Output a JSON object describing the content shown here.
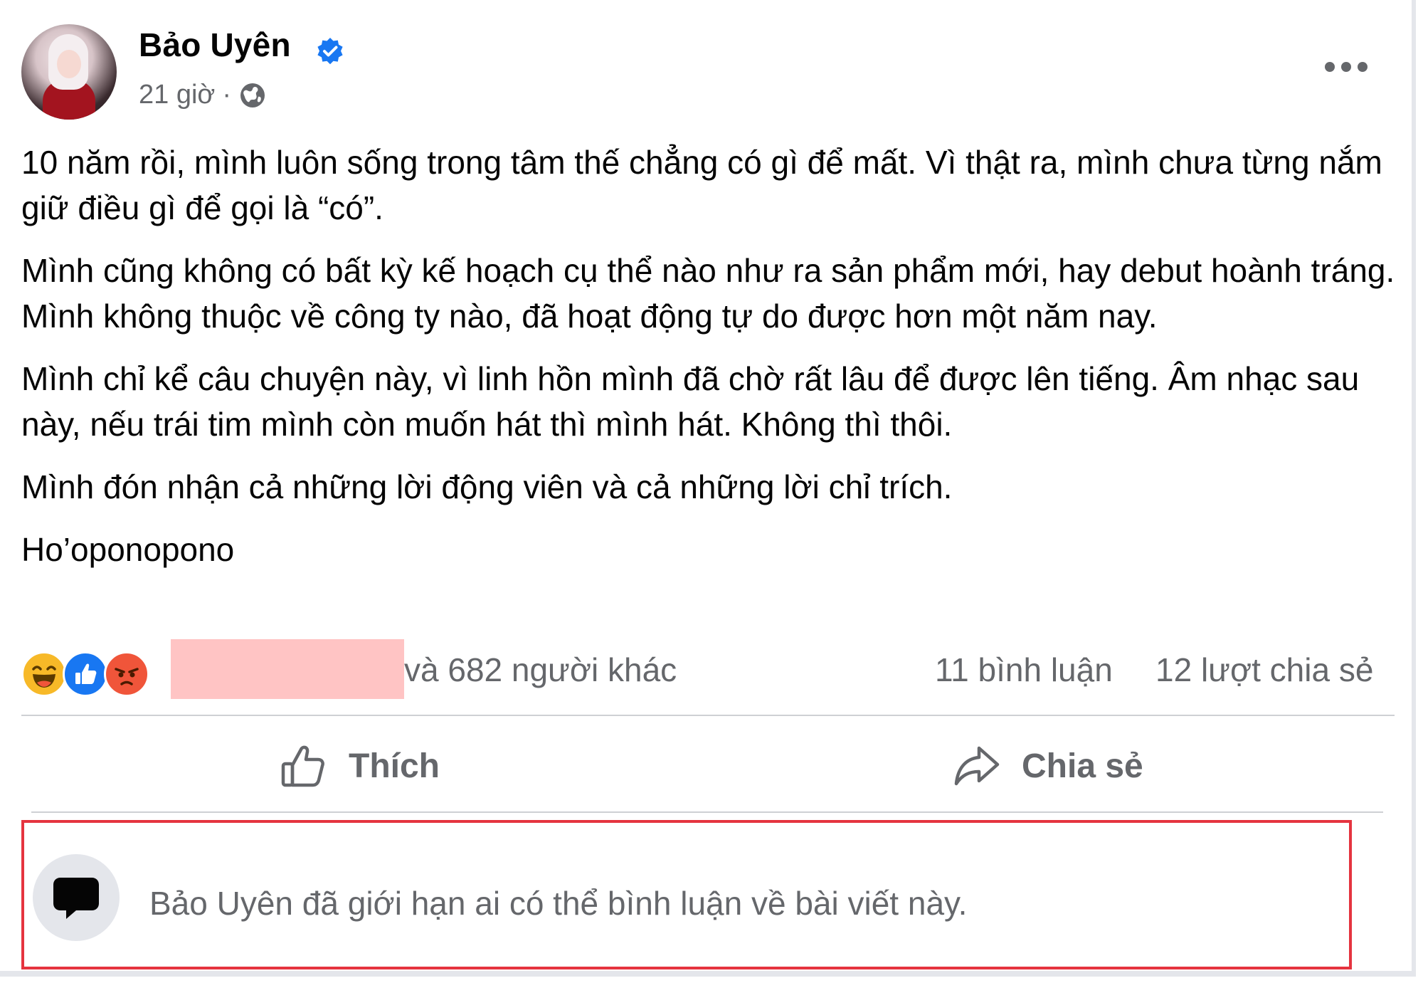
{
  "post": {
    "author": "Bảo Uyên",
    "time": "21 giờ",
    "separator": "·",
    "paragraphs": [
      "10 năm rồi, mình luôn sống trong tâm thế chẳng có gì để mất. Vì thật ra, mình chưa từng nắm giữ điều gì để gọi là “có”.",
      "Mình cũng không có bất kỳ kế hoạch cụ thể nào như ra sản phẩm mới, hay debut hoành tráng. Mình không thuộc về công ty nào, đã hoạt động tự do được hơn một năm nay.",
      "Mình chỉ kể câu chuyện này, vì linh hồn mình đã chờ rất lâu để được lên tiếng. Âm nhạc sau này, nếu trái tim mình còn muốn hát thì mình hát. Không thì thôi.",
      "Mình đón nhận cả những lời động viên và cả những lời chỉ trích.",
      "Ho’oponopono"
    ]
  },
  "stats": {
    "reactions": [
      "haha",
      "like",
      "angry"
    ],
    "others": "và 682 người khác",
    "comments": "11 bình luận",
    "shares": "12 lượt chia sẻ"
  },
  "actions": {
    "like_label": "Thích",
    "share_label": "Chia sẻ"
  },
  "comment_notice": "Bảo Uyên đã giới hạn ai có thể bình luận về bài viết này.",
  "colors": {
    "verified": "#1877f2",
    "muted_text": "#65676b",
    "highlight_border": "#e5343f",
    "redaction": "#ffc4c4"
  }
}
